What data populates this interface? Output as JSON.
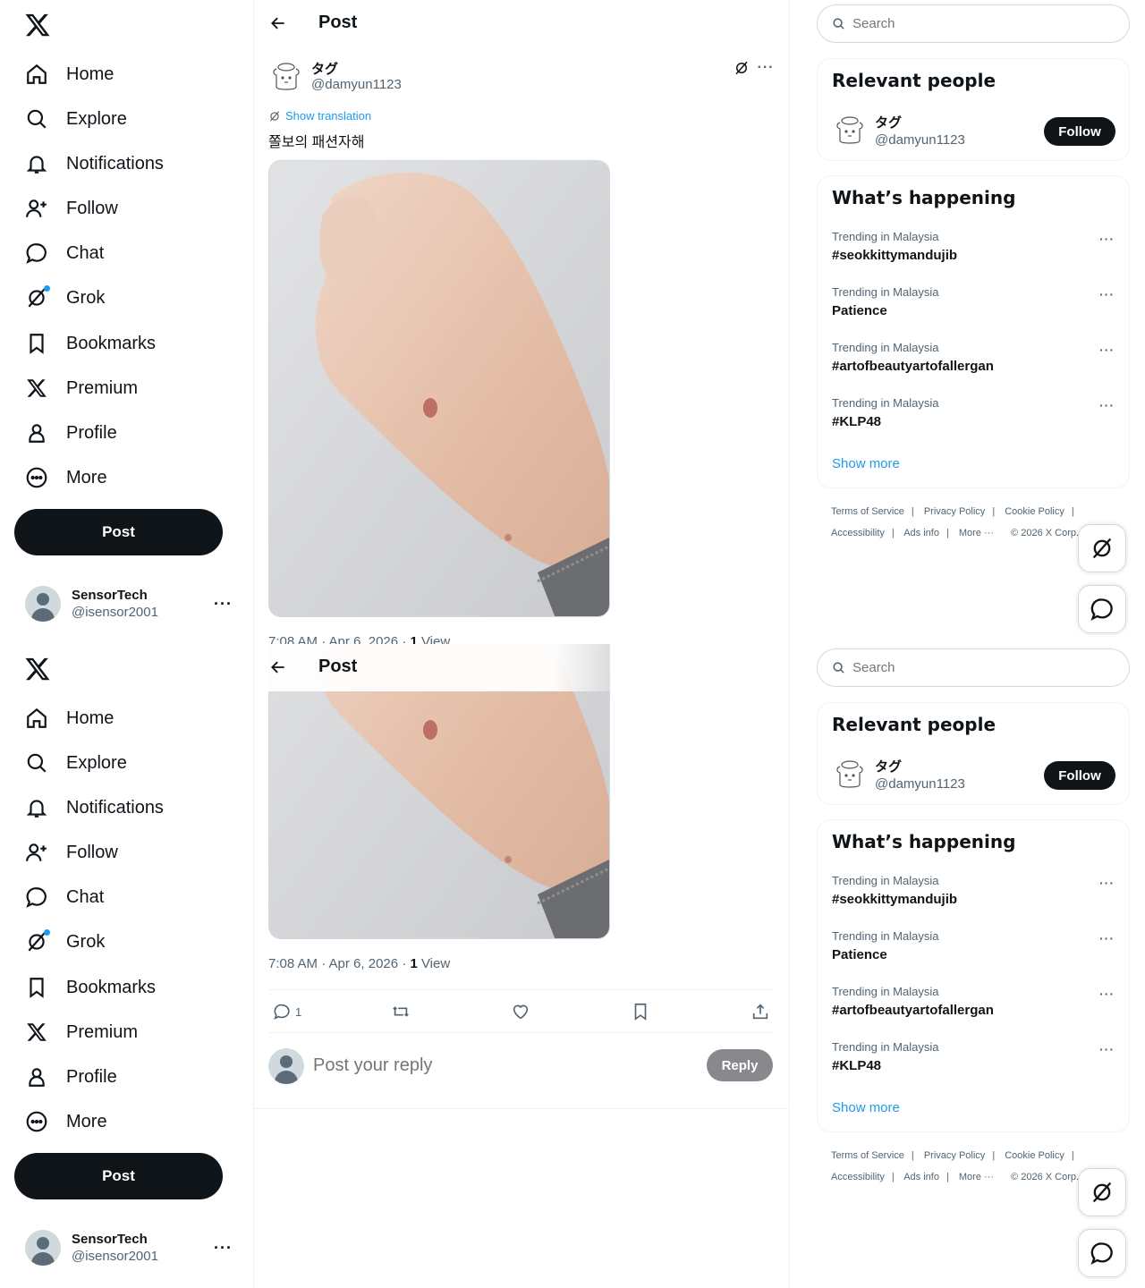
{
  "nav": {
    "items": [
      {
        "label": "Home",
        "icon": "home-icon"
      },
      {
        "label": "Explore",
        "icon": "search-icon"
      },
      {
        "label": "Notifications",
        "icon": "bell-icon"
      },
      {
        "label": "Follow",
        "icon": "follow-icon"
      },
      {
        "label": "Chat",
        "icon": "chat-icon"
      },
      {
        "label": "Grok",
        "icon": "grok-icon"
      },
      {
        "label": "Bookmarks",
        "icon": "bookmark-icon"
      },
      {
        "label": "Premium",
        "icon": "x-logo-icon"
      },
      {
        "label": "Profile",
        "icon": "person-icon"
      },
      {
        "label": "More",
        "icon": "more-circle-icon"
      }
    ],
    "post_button": "Post"
  },
  "account": {
    "name": "SensorTech",
    "handle": "@isensor2001",
    "more": "···"
  },
  "header": {
    "title": "Post"
  },
  "post": {
    "author_name": "タグ",
    "author_handle": "@damyun1123",
    "translate_label": "Show translation",
    "text": "쫄보의 패션자해",
    "time": "7:08 AM · Apr 6, 2026 · ",
    "views_count": "1",
    "views_label": " View",
    "reply_count": "1"
  },
  "reply": {
    "placeholder": "Post your reply",
    "button": "Reply"
  },
  "search": {
    "placeholder": "Search"
  },
  "relevant": {
    "title": "Relevant people",
    "name": "タグ",
    "handle": "@damyun1123",
    "follow": "Follow"
  },
  "happening": {
    "title": "What’s happening",
    "trends": [
      {
        "context": "Trending in Malaysia",
        "name": "#seokkittymandujib"
      },
      {
        "context": "Trending in Malaysia",
        "name": "Patience"
      },
      {
        "context": "Trending in Malaysia",
        "name": "#artofbeautyartofallergan"
      },
      {
        "context": "Trending in Malaysia",
        "name": "#KLP48"
      }
    ],
    "show_more": "Show more"
  },
  "footer": {
    "links": [
      "Terms of Service",
      "Privacy Policy",
      "Cookie Policy",
      "Accessibility",
      "Ads info",
      "More ···"
    ],
    "copyright": "© 2026 X Corp."
  },
  "colors": {
    "accent": "#1d9bf0",
    "text": "#0f1419",
    "muted": "#536471",
    "border": "#eff3f4"
  }
}
